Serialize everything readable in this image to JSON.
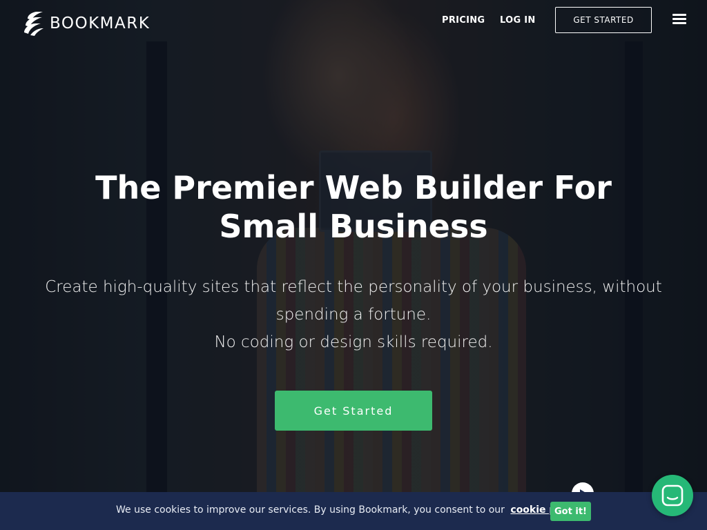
{
  "brand": {
    "name": "BOOKMARK",
    "logo_icon": "bookmark-logo-icon"
  },
  "nav": {
    "pricing": "PRICING",
    "login": "LOG IN",
    "get_started": "GET STARTED",
    "menu_icon": "hamburger-menu-icon"
  },
  "hero": {
    "title": "The Premier Web Builder For Small Business",
    "subtitle_line1": "Create high-quality sites that reflect the personality of your business, without spending a fortune.",
    "subtitle_line2": "No coding or design skills required.",
    "cta": "Get Started",
    "play_icon": "play-icon"
  },
  "cookie_bar": {
    "text": "We use cookies to improve our services. By using Bookmark, you consent to our",
    "link": "cookie policy.",
    "button": "Got it!"
  },
  "chat": {
    "icon": "chat-icon"
  },
  "colors": {
    "accent_green": "#3dba6f",
    "chat_green": "#26b877",
    "cookie_bar_bg": "#1c2a4e"
  }
}
